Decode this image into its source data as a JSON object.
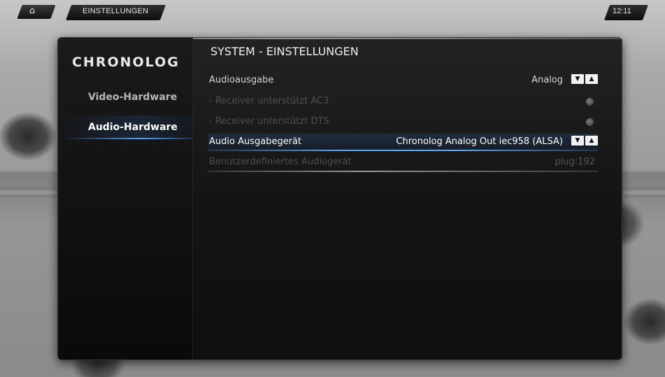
{
  "topbar": {
    "home_icon": "home-icon",
    "title": "EINSTELLUNGEN",
    "clock": "12:11"
  },
  "sidebar": {
    "logo": "CHRONOLOG",
    "items": [
      {
        "label": "Video-Hardware",
        "active": false
      },
      {
        "label": "Audio-Hardware",
        "active": true
      }
    ]
  },
  "main": {
    "heading": "SYSTEM - EINSTELLUNGEN",
    "rows": [
      {
        "label": "Audioausgabe",
        "value": "Analog",
        "control": "spinner",
        "enabled": true,
        "selected": false
      },
      {
        "label": "- Receiver unterstützt AC3",
        "value": "",
        "control": "radio",
        "enabled": false,
        "selected": false
      },
      {
        "label": "- Receiver unterstützt DTS",
        "value": "",
        "control": "radio",
        "enabled": false,
        "selected": false
      },
      {
        "label": "Audio Ausgabegerät",
        "value": "Chronolog Analog Out iec958 (ALSA)",
        "control": "spinner",
        "enabled": true,
        "selected": true
      },
      {
        "label": "Benutzerdefiniertes Audiogerät",
        "value": "plug:192",
        "control": "none",
        "enabled": false,
        "selected": false
      }
    ],
    "spinner_down": "▼",
    "spinner_up": "▲"
  },
  "colors": {
    "accent": "#4aa0ff",
    "panel": "#141414",
    "text": "#d6d6d6",
    "disabled_text": "#4f4f4f"
  }
}
